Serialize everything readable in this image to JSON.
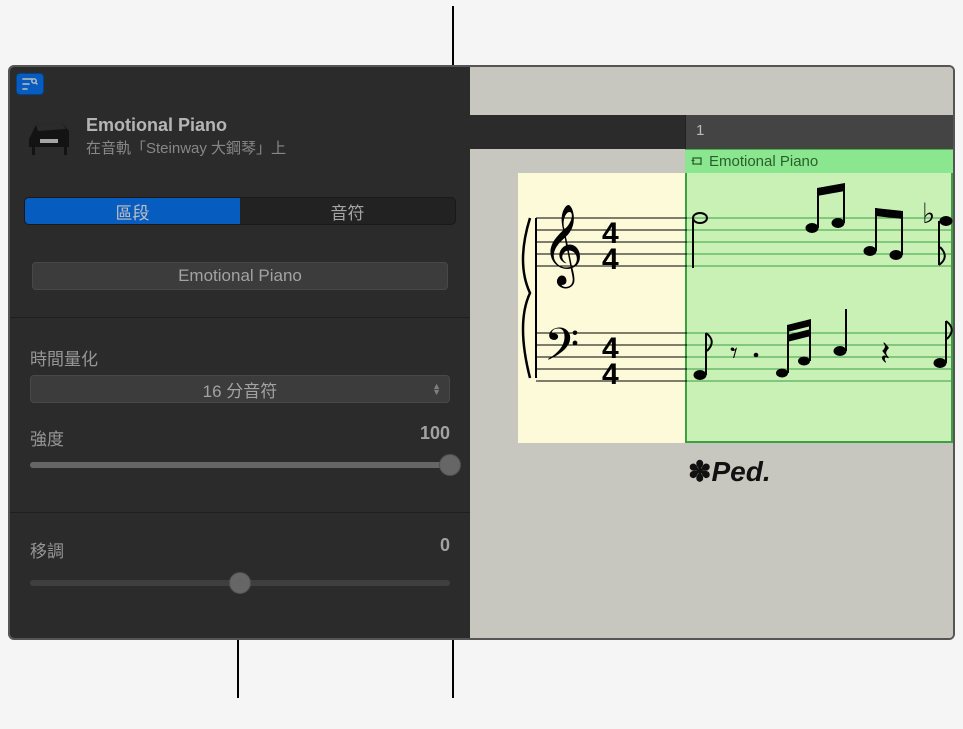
{
  "track": {
    "name": "Emotional Piano",
    "subtitle": "在音軌「Steinway 大鋼琴」上"
  },
  "tabs": {
    "region": "區段",
    "note": "音符"
  },
  "regionName": "Emotional Piano",
  "quantize": {
    "label": "時間量化",
    "value": "16 分音符"
  },
  "strength": {
    "label": "強度",
    "value": "100"
  },
  "transpose": {
    "label": "移調",
    "value": "0"
  },
  "ruler": {
    "bar": "1"
  },
  "regionClip": {
    "title": "Emotional Piano"
  },
  "pedal": "Ped.",
  "timeSignature": {
    "num": "4",
    "den": "4"
  }
}
